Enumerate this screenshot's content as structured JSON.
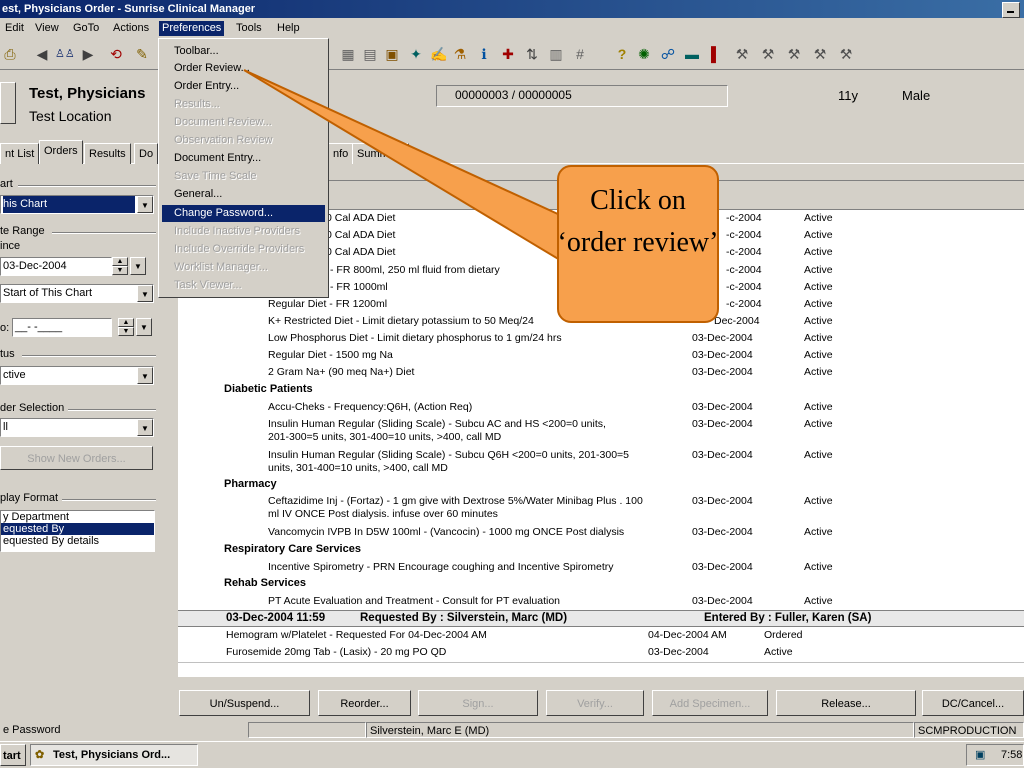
{
  "window": {
    "title": "est, Physicians Order - Sunrise Clinical Manager"
  },
  "menu": [
    "Edit",
    "View",
    "GoTo",
    "Actions",
    "Preferences",
    "Tools",
    "Help"
  ],
  "preferences_menu": [
    {
      "label": "Toolbar...",
      "enabled": true
    },
    {
      "label": "Order Review...",
      "enabled": true
    },
    {
      "label": "Order Entry...",
      "enabled": true
    },
    {
      "label": "Results...",
      "enabled": false
    },
    {
      "label": "Document Review...",
      "enabled": false
    },
    {
      "label": "Observation Review",
      "enabled": false
    },
    {
      "label": "Document Entry...",
      "enabled": true
    },
    {
      "label": "Save Time Scale",
      "enabled": false
    },
    {
      "label": "General...",
      "enabled": true
    },
    {
      "label": "Change Password...",
      "enabled": true,
      "highlighted": true
    },
    {
      "label": "Include Inactive Providers",
      "enabled": false
    },
    {
      "label": "Include Override Providers",
      "enabled": false
    },
    {
      "label": "Worklist Manager...",
      "enabled": false
    },
    {
      "label": "Task Viewer...",
      "enabled": false
    }
  ],
  "patient": {
    "name": "Test, Physicians",
    "location": "Test Location",
    "ids": "00000003 / 00000005",
    "age": "11y",
    "sex": "Male"
  },
  "tabs": [
    "nt List",
    "Orders",
    "Results",
    "Do",
    "nfo",
    "Summary"
  ],
  "left_panel": {
    "chart_label": "art",
    "chart_value": "his Chart",
    "date_range_label": "te Range",
    "since_label": "ince",
    "since_date": "03-Dec-2004",
    "start_value": "Start of This Chart",
    "to_label": "o:",
    "to_value": "__-   -____",
    "status_label": "tus",
    "status_value": "ctive",
    "order_sel_label": "der Selection",
    "order_sel_value": "ll",
    "show_new_orders": "Show New Orders...",
    "display_format_label": "play Format",
    "display_format_options": [
      "y Department",
      "equested By",
      "equested By details"
    ]
  },
  "orders": {
    "top_rows": [
      {
        "desc": "0 Cal ADA Diet",
        "date": "-c-2004",
        "status": "Active"
      },
      {
        "desc": "0 Cal ADA Diet",
        "date": "-c-2004",
        "status": "Active"
      },
      {
        "desc": "0 Cal ADA Diet",
        "date": "-c-2004",
        "status": "Active"
      },
      {
        "desc": "- FR 800ml, 250 ml fluid from dietary",
        "date": "-c-2004",
        "status": "Active"
      },
      {
        "desc": "- FR 1000ml",
        "date": "-c-2004",
        "status": "Active"
      },
      {
        "desc": "Regular Diet - FR 1200ml",
        "date": "-c-2004",
        "status": "Active"
      },
      {
        "desc": "K+ Restricted Diet - Limit dietary potassium to 50 Meq/24",
        "date": "Dec-2004",
        "status": "Active"
      },
      {
        "desc": "Low Phosphorus Diet - Limit dietary phosphorus to 1 gm/24 hrs",
        "date": "03-Dec-2004",
        "status": "Active"
      },
      {
        "desc": "Regular Diet - 1500 mg Na",
        "date": "03-Dec-2004",
        "status": "Active"
      },
      {
        "desc": "2 Gram Na+ (90 meq Na+) Diet",
        "date": "03-Dec-2004",
        "status": "Active"
      }
    ],
    "cat_diabetic": "Diabetic Patients",
    "diabetic_rows": [
      {
        "desc": "Accu-Cheks -  Frequency:Q6H, (Action Req)",
        "date": "03-Dec-2004",
        "status": "Active"
      },
      {
        "desc": "Insulin Human Regular (Sliding Scale) - Subcu AC and HS <200=0 units,\n201-300=5 units, 301-400=10 units, >400, call MD",
        "date": "03-Dec-2004",
        "status": "Active"
      },
      {
        "desc": "Insulin Human Regular (Sliding Scale) - Subcu Q6H <200=0 units, 201-300=5\nunits, 301-400=10 units, >400, call MD",
        "date": "03-Dec-2004",
        "status": "Active"
      }
    ],
    "cat_pharmacy": "Pharmacy",
    "pharmacy_rows": [
      {
        "desc": "Ceftazidime  Inj - (Fortaz) - 1 gm give with Dextrose 5%/Water Minibag Plus . 100\nml IV ONCE Post dialysis. infuse over 60 minutes",
        "date": "03-Dec-2004",
        "status": "Active"
      },
      {
        "desc": "Vancomycin IVPB In D5W 100ml - (Vancocin) - 1000 mg ONCE Post dialysis",
        "date": "03-Dec-2004",
        "status": "Active"
      }
    ],
    "cat_resp": "Respiratory Care Services",
    "resp_rows": [
      {
        "desc": "Incentive Spirometry - PRN Encourage coughing and Incentive Spirometry",
        "date": "03-Dec-2004",
        "status": "Active"
      }
    ],
    "cat_rehab": "Rehab Services",
    "rehab_rows": [
      {
        "desc": "PT Acute   Evaluation and Treatment - Consult for PT evaluation",
        "date": "03-Dec-2004",
        "status": "Active"
      }
    ],
    "group_header": {
      "datetime": "03-Dec-2004 11:59",
      "requested_by": "Requested By :  Silverstein, Marc (MD)",
      "entered_by": "Entered By :  Fuller, Karen (SA)"
    },
    "group_rows": [
      {
        "desc": "Hemogram w/Platelet - Requested For 04-Dec-2004 AM",
        "date": "04-Dec-2004 AM",
        "status": "Ordered"
      },
      {
        "desc": "Furosemide  20mg Tab - (Lasix) - 20 mg PO QD",
        "date": "03-Dec-2004",
        "status": "Active"
      }
    ]
  },
  "buttons": [
    {
      "label": "Un/Suspend...",
      "enabled": true
    },
    {
      "label": "Reorder...",
      "enabled": true
    },
    {
      "label": "Sign...",
      "enabled": false
    },
    {
      "label": "Verify...",
      "enabled": false
    },
    {
      "label": "Add Specimen...",
      "enabled": false
    },
    {
      "label": "Release...",
      "enabled": true
    },
    {
      "label": "DC/Cancel...",
      "enabled": true
    }
  ],
  "statusbar": {
    "left": "e Password",
    "user": "Silverstein, Marc E (MD)",
    "env": "SCMPRODUCTION"
  },
  "taskbar": {
    "start": "tart",
    "task": "Test, Physicians Ord...",
    "clock": "7:58"
  },
  "callout": {
    "text": "Click on ‘order review’",
    "color": "#f7a04c"
  },
  "colors": {
    "selection": "#0a246a",
    "face": "#d4d0c8"
  }
}
